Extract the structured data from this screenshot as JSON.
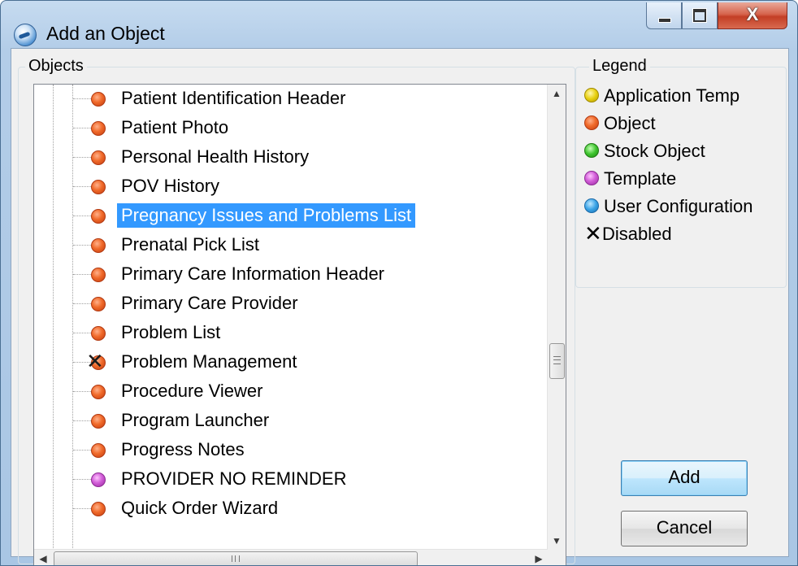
{
  "window": {
    "title": "Add an Object",
    "controls": {
      "minimize": "–",
      "maximize": "□",
      "close": "X"
    }
  },
  "objects_group": {
    "label": "Objects"
  },
  "tree": {
    "items": [
      {
        "label": "Patient Identification Header",
        "type": "object"
      },
      {
        "label": "Patient Photo",
        "type": "object"
      },
      {
        "label": "Personal Health History",
        "type": "object"
      },
      {
        "label": "POV History",
        "type": "object"
      },
      {
        "label": "Pregnancy Issues and Problems List",
        "type": "object",
        "selected": true
      },
      {
        "label": "Prenatal Pick List",
        "type": "object"
      },
      {
        "label": "Primary Care Information Header",
        "type": "object"
      },
      {
        "label": "Primary Care Provider",
        "type": "object"
      },
      {
        "label": "Problem List",
        "type": "object"
      },
      {
        "label": "Problem Management",
        "type": "disabled"
      },
      {
        "label": "Procedure Viewer",
        "type": "object"
      },
      {
        "label": "Program Launcher",
        "type": "object"
      },
      {
        "label": "Progress Notes",
        "type": "object"
      },
      {
        "label": "PROVIDER NO REMINDER",
        "type": "template"
      },
      {
        "label": "Quick Order Wizard",
        "type": "object"
      }
    ],
    "scroll": {
      "vertical_position": 0.58,
      "horizontal_position": 0.0
    }
  },
  "legend": {
    "label": "Legend",
    "items": [
      {
        "label": "Application Temp",
        "color": "#e8d010"
      },
      {
        "label": "Object",
        "color": "#f06a2a"
      },
      {
        "label": "Stock Object",
        "color": "#3ec42e"
      },
      {
        "label": "Template",
        "color": "#d25ed8"
      },
      {
        "label": "User Configuration",
        "color": "#3aa3e6"
      },
      {
        "label": "Disabled",
        "icon": "x-icon"
      }
    ]
  },
  "buttons": {
    "add": "Add",
    "cancel": "Cancel"
  }
}
